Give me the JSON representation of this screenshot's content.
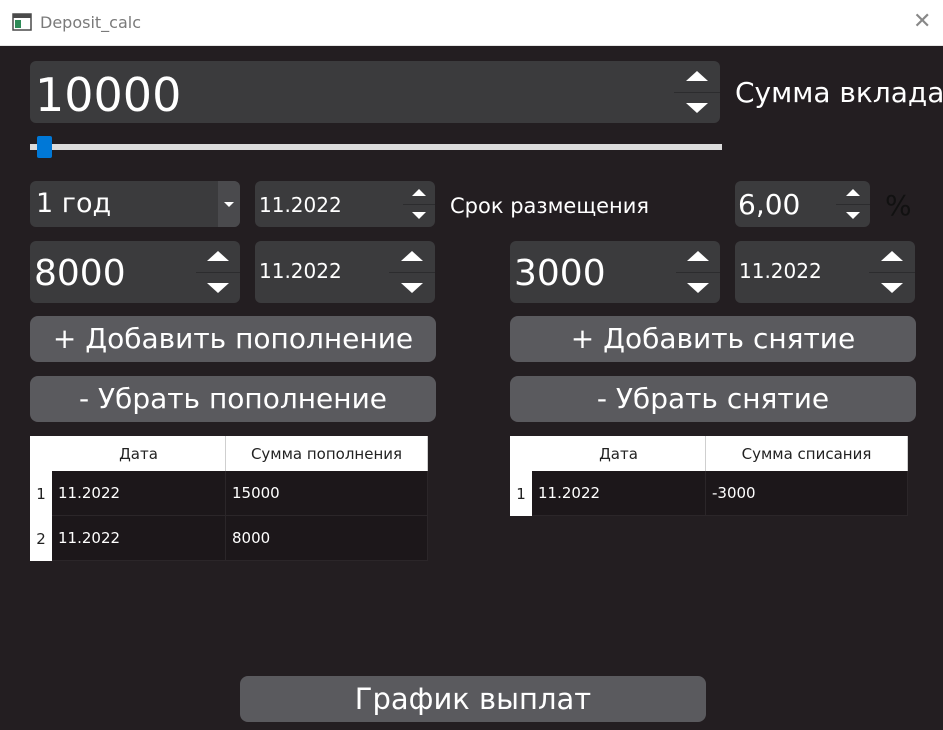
{
  "window": {
    "title": "Deposit_calc",
    "icon": "app-window-icon",
    "close_icon": "close-icon"
  },
  "deposit": {
    "amount": "10000",
    "label": "Сумма вклада",
    "slider_fraction": 0.01
  },
  "term": {
    "period": "1 год",
    "start_date": "11.2022",
    "label": "Срок размещения",
    "rate": "6,00",
    "rate_unit": "%"
  },
  "replenish": {
    "amount": "8000",
    "date": "11.2022",
    "add_label": "+ Добавить пополнение",
    "remove_label": "- Убрать пополнение"
  },
  "withdraw": {
    "amount": "3000",
    "date": "11.2022",
    "add_label": "+ Добавить снятие",
    "remove_label": "- Убрать снятие"
  },
  "replenish_table": {
    "headers": [
      "Дата",
      "Сумма пополнения"
    ],
    "rows": [
      {
        "num": "1",
        "date": "11.2022",
        "sum": "15000"
      },
      {
        "num": "2",
        "date": "11.2022",
        "sum": "8000"
      }
    ]
  },
  "withdraw_table": {
    "headers": [
      "Дата",
      "Сумма списания"
    ],
    "rows": [
      {
        "num": "1",
        "date": "11.2022",
        "sum": "-3000"
      }
    ]
  },
  "schedule_button": "График выплат",
  "colors": {
    "background": "#231e21",
    "field": "#3b3b3d",
    "button": "#5a5a5e",
    "accent": "#0078d7"
  }
}
